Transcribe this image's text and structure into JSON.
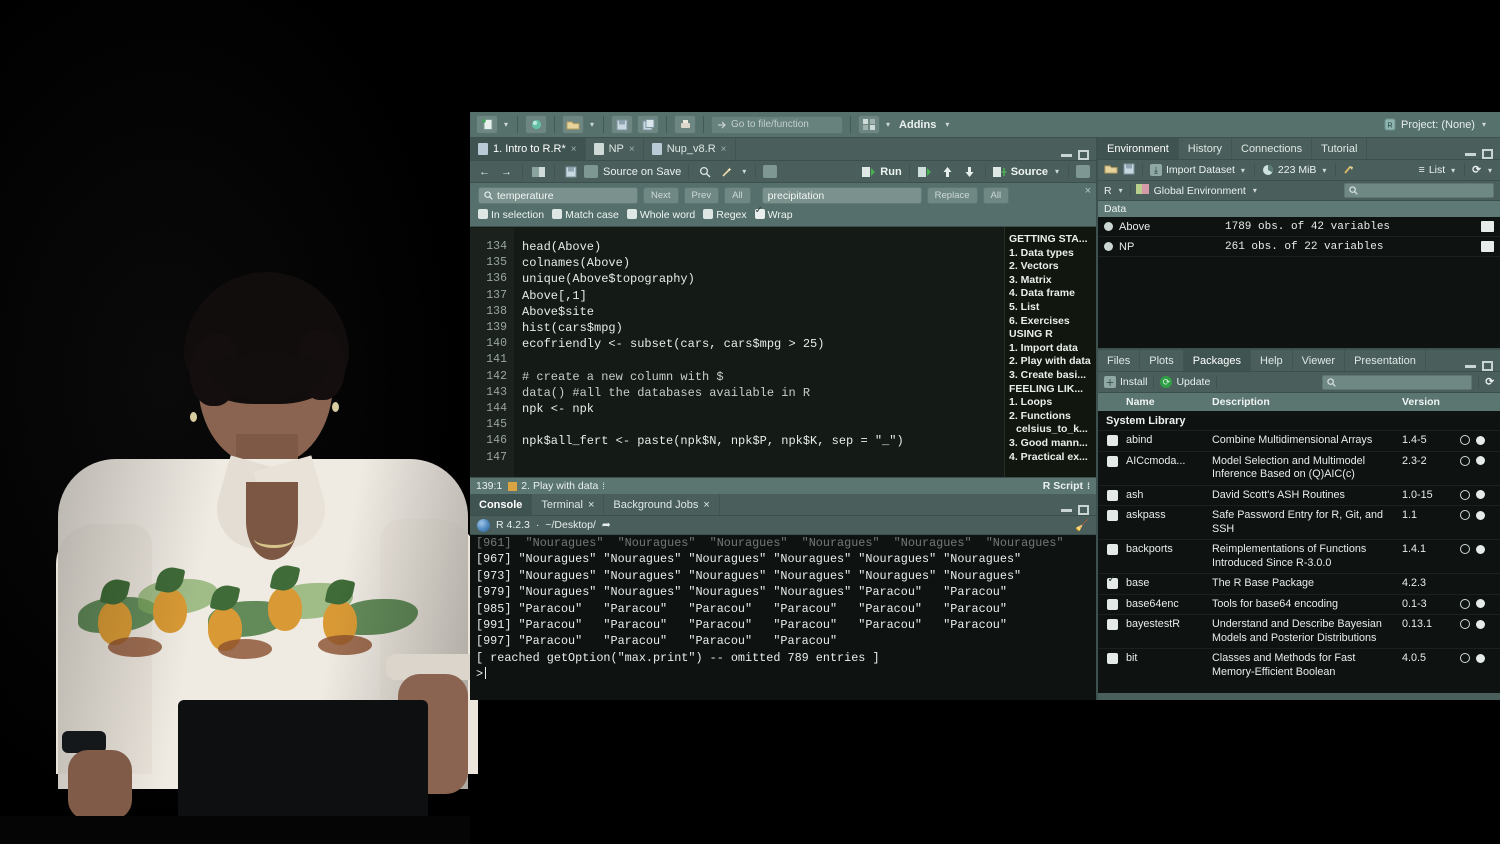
{
  "app": {
    "name": "RStudio",
    "project_label": "Project: (None)",
    "addins_label": "Addins",
    "goto_placeholder": "Go to file/function"
  },
  "source_pane": {
    "tabs": [
      {
        "label": "1. Intro to R.R*",
        "active": true,
        "closable": true,
        "icon": "r-script-icon"
      },
      {
        "label": "NP",
        "active": false,
        "closable": true,
        "icon": "data-frame-icon"
      },
      {
        "label": "Nup_v8.R",
        "active": false,
        "closable": true,
        "icon": "r-script-icon"
      }
    ],
    "toolbar": {
      "back_icon": "arrow-left-icon",
      "forward_icon": "arrow-right-icon",
      "source_on_save_label": "Source on Save",
      "find_icon": "magnifier-icon",
      "magic_icon": "magic-wand-icon",
      "run_label": "Run",
      "rerun_icon": "rerun-icon",
      "up_icon": "arrow-up-icon",
      "down_icon": "arrow-down-icon",
      "source_label": "Source"
    },
    "find": {
      "find_value": "temperature",
      "replace_value": "precipitation",
      "next_label": "Next",
      "prev_label": "Prev",
      "all_label": "All",
      "replace_label": "Replace",
      "replace_all_label": "All",
      "options": [
        {
          "label": "In selection",
          "checked": false
        },
        {
          "label": "Match case",
          "checked": false
        },
        {
          "label": "Whole word",
          "checked": false
        },
        {
          "label": "Regex",
          "checked": false
        },
        {
          "label": "Wrap",
          "checked": true
        }
      ]
    },
    "code_lines": [
      {
        "n": "134",
        "text": "head(Above)"
      },
      {
        "n": "135",
        "text": "colnames(Above)"
      },
      {
        "n": "136",
        "text": "unique(Above$topography)"
      },
      {
        "n": "137",
        "text": "Above[,1]",
        "num": "1"
      },
      {
        "n": "138",
        "text": "Above$site"
      },
      {
        "n": "139",
        "text": "hist(cars$mpg)"
      },
      {
        "n": "140",
        "text": "ecofriendly <- subset(cars, cars$mpg > 25)",
        "num": "25"
      },
      {
        "n": "141",
        "text": ""
      },
      {
        "n": "142",
        "text": "# create a new column with $",
        "comment": true
      },
      {
        "n": "143",
        "text": "data() #all the databases available in R",
        "comment": true
      },
      {
        "n": "144",
        "text": "npk <- npk"
      },
      {
        "n": "145",
        "text": ""
      },
      {
        "n": "146",
        "text": "npk$all_fert <- paste(npk$N, npk$P, npk$K, sep = \"_\")"
      },
      {
        "n": "147",
        "text": ""
      }
    ],
    "outline": [
      {
        "label": "GETTING STA...",
        "indent": false,
        "selected": false
      },
      {
        "label": "1. Data types",
        "indent": false,
        "selected": false
      },
      {
        "label": "2. Vectors",
        "indent": false,
        "selected": false
      },
      {
        "label": "3. Matrix",
        "indent": false,
        "selected": false
      },
      {
        "label": "4. Data frame",
        "indent": false,
        "selected": false
      },
      {
        "label": "5. List",
        "indent": false,
        "selected": false
      },
      {
        "label": "6. Exercises",
        "indent": false,
        "selected": false
      },
      {
        "label": "USING R",
        "indent": false,
        "selected": false
      },
      {
        "label": "1. Import data",
        "indent": false,
        "selected": false
      },
      {
        "label": "2. Play with data",
        "indent": false,
        "selected": true
      },
      {
        "label": "3. Create basi...",
        "indent": false,
        "selected": false
      },
      {
        "label": "FEELING LIK...",
        "indent": false,
        "selected": false
      },
      {
        "label": "1. Loops",
        "indent": false,
        "selected": false
      },
      {
        "label": "2. Functions",
        "indent": false,
        "selected": false
      },
      {
        "label": "celsius_to_k...",
        "indent": true,
        "selected": false
      },
      {
        "label": "3. Good mann...",
        "indent": false,
        "selected": false
      },
      {
        "label": "4. Practical ex...",
        "indent": false,
        "selected": false
      }
    ],
    "status": {
      "cursor_position": "139:1",
      "section_label": "2. Play with data",
      "file_type": "R Script"
    }
  },
  "console_pane": {
    "tabs": [
      {
        "label": "Console",
        "active": true,
        "closable": false
      },
      {
        "label": "Terminal",
        "active": false,
        "closable": true
      },
      {
        "label": "Background Jobs",
        "active": false,
        "closable": true
      }
    ],
    "r_version": "R 4.2.3",
    "working_dir": "~/Desktop/",
    "output_lines": [
      "[961]  \"Nouragues\"  \"Nouragues\"  \"Nouragues\"  \"Nouragues\"  \"Nouragues\"  \"Nouragues\"",
      "[967] \"Nouragues\" \"Nouragues\" \"Nouragues\" \"Nouragues\" \"Nouragues\" \"Nouragues\"",
      "[973] \"Nouragues\" \"Nouragues\" \"Nouragues\" \"Nouragues\" \"Nouragues\" \"Nouragues\"",
      "[979] \"Nouragues\" \"Nouragues\" \"Nouragues\" \"Nouragues\" \"Paracou\"   \"Paracou\"",
      "[985] \"Paracou\"   \"Paracou\"   \"Paracou\"   \"Paracou\"   \"Paracou\"   \"Paracou\"",
      "[991] \"Paracou\"   \"Paracou\"   \"Paracou\"   \"Paracou\"   \"Paracou\"   \"Paracou\"",
      "[997] \"Paracou\"   \"Paracou\"   \"Paracou\"   \"Paracou\"",
      "[ reached getOption(\"max.print\") -- omitted 789 entries ]"
    ],
    "prompt": ">"
  },
  "environment_pane": {
    "tabs": [
      {
        "label": "Environment",
        "active": true
      },
      {
        "label": "History",
        "active": false
      },
      {
        "label": "Connections",
        "active": false
      },
      {
        "label": "Tutorial",
        "active": false
      }
    ],
    "toolbar": {
      "open_icon": "folder-open-icon",
      "save_icon": "save-icon",
      "import_label": "Import Dataset",
      "memory_label": "223 MiB",
      "broom_icon": "broom-icon",
      "view_label": "List",
      "refresh_icon": "refresh-icon"
    },
    "language": "R",
    "scope": "Global Environment",
    "search_placeholder": "",
    "group_label": "Data",
    "items": [
      {
        "name": "Above",
        "value": "1789 obs. of 42 variables"
      },
      {
        "name": "NP",
        "value": "261 obs. of 22 variables"
      }
    ]
  },
  "packages_pane": {
    "tabs": [
      {
        "label": "Files",
        "active": false
      },
      {
        "label": "Plots",
        "active": false
      },
      {
        "label": "Packages",
        "active": true
      },
      {
        "label": "Help",
        "active": false
      },
      {
        "label": "Viewer",
        "active": false
      },
      {
        "label": "Presentation",
        "active": false
      }
    ],
    "toolbar": {
      "install_label": "Install",
      "update_label": "Update",
      "search_placeholder": "",
      "refresh_icon": "refresh-icon"
    },
    "columns": [
      "Name",
      "Description",
      "Version"
    ],
    "library_label": "System Library",
    "rows": [
      {
        "checked": false,
        "name": "abind",
        "description": "Combine Multidimensional Arrays",
        "version": "1.4-5",
        "links": true
      },
      {
        "checked": false,
        "name": "AICcmoda...",
        "description": "Model Selection and Multimodel Inference Based on (Q)AIC(c)",
        "version": "2.3-2",
        "links": true
      },
      {
        "checked": false,
        "name": "ash",
        "description": "David Scott's ASH Routines",
        "version": "1.0-15",
        "links": true
      },
      {
        "checked": false,
        "name": "askpass",
        "description": "Safe Password Entry for R, Git, and SSH",
        "version": "1.1",
        "links": true
      },
      {
        "checked": false,
        "name": "backports",
        "description": "Reimplementations of Functions Introduced Since R-3.0.0",
        "version": "1.4.1",
        "links": true
      },
      {
        "checked": true,
        "name": "base",
        "description": "The R Base Package",
        "version": "4.2.3",
        "links": false
      },
      {
        "checked": false,
        "name": "base64enc",
        "description": "Tools for base64 encoding",
        "version": "0.1-3",
        "links": true
      },
      {
        "checked": false,
        "name": "bayestestR",
        "description": "Understand and Describe Bayesian Models and Posterior Distributions",
        "version": "0.13.1",
        "links": true
      },
      {
        "checked": false,
        "name": "bit",
        "description": "Classes and Methods for Fast Memory-Efficient Boolean",
        "version": "4.0.5",
        "links": true
      }
    ]
  },
  "colors": {
    "chrome": "#4a5f5c",
    "chrome_light": "#56706c",
    "editor_bg": "#141a16",
    "console_bg": "#0e1311",
    "accent_green": "#2f9e44",
    "number_orange": "#d98a4a",
    "page_bg": "#000000"
  }
}
